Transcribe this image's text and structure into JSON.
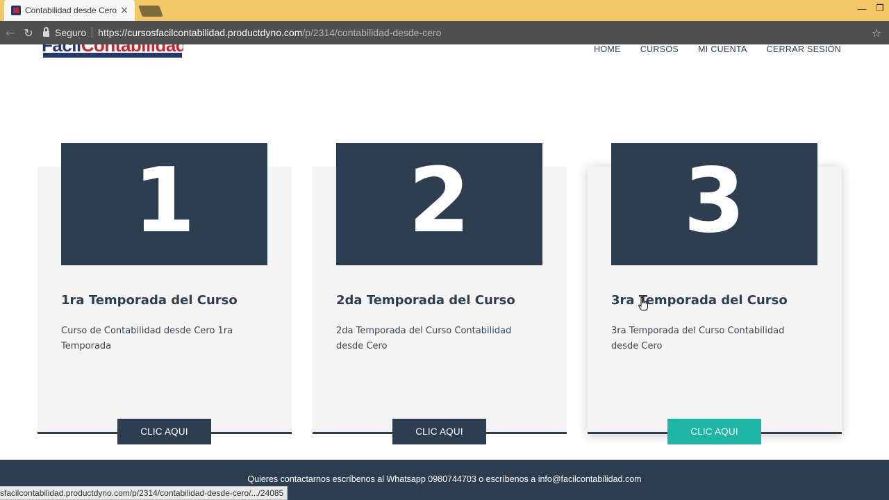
{
  "browser": {
    "tab_title": "Contabilidad desde Cero",
    "tab_close": "×",
    "secure_label": "Seguro",
    "url_scheme": "https://",
    "url_host": "cursosfacilcontabilidad.productdyno.com",
    "url_path": "/p/2314/contabilidad-desde-cero",
    "status_url": "sfacilcontabilidad.productdyno.com/p/2314/contabilidad-desde-cero/.../24085",
    "win_minimize": "—",
    "win_restore": "❐",
    "nav_back": "←",
    "nav_reload": "↻",
    "bookmark_star": "☆"
  },
  "site": {
    "logo_text_a": "Facil",
    "logo_text_b": "Contabilidad",
    "nav": [
      "HOME",
      "CURSOS",
      "MI CUENTA",
      "CERRAR SESIÓN"
    ]
  },
  "cards": [
    {
      "number": "1",
      "title": "1ra Temporada del Curso",
      "description": "Curso de Contabilidad desde Cero 1ra Temporada",
      "button": "CLIC AQUI"
    },
    {
      "number": "2",
      "title": "2da Temporada del Curso",
      "description": "2da Temporada del Curso Contabilidad desde Cero",
      "button": "CLIC AQUI"
    },
    {
      "number": "3",
      "title": "3ra Temporada del Curso",
      "description": "3ra Temporada del Curso Contabilidad desde Cero",
      "button": "CLIC AQUI"
    }
  ],
  "footer": {
    "text": "Quieres contactarnos escríbenos al Whatsapp 0980744703 o escríbenos a info@facilcontabilidad.com"
  },
  "colors": {
    "tabbar": "#f2c766",
    "navy": "#2d3e50",
    "teal": "#1fb5a5",
    "card_bg": "#f4f4f4"
  }
}
